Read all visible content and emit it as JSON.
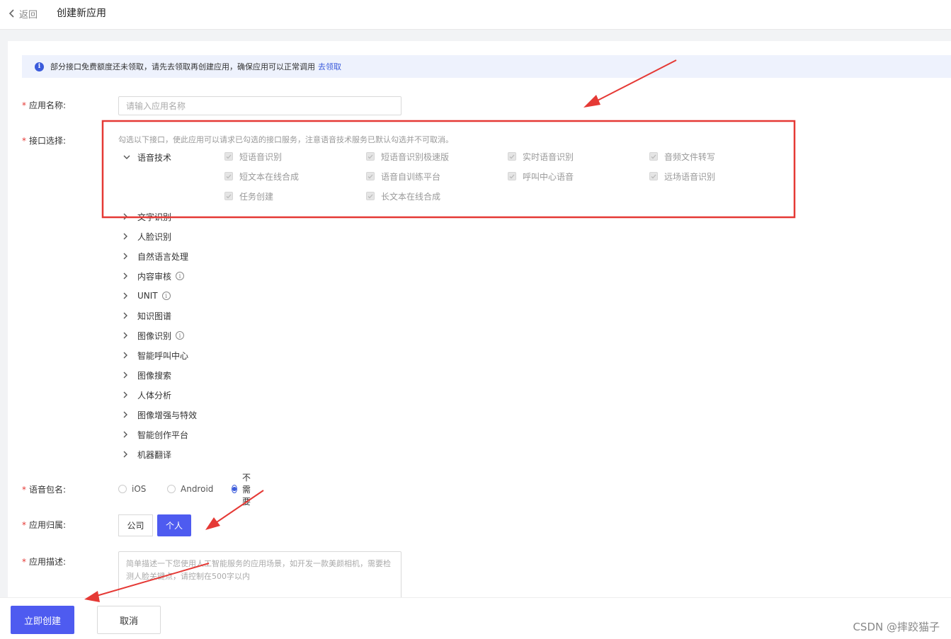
{
  "header": {
    "back_label": "返回",
    "title": "创建新应用"
  },
  "notice": {
    "text": "部分接口免费额度还未领取，请先去领取再创建应用，确保应用可以正常调用",
    "link": "去领取"
  },
  "form": {
    "app_name": {
      "label": "应用名称:",
      "placeholder": "请输入应用名称"
    },
    "api_select": {
      "label": "接口选择:",
      "hint": "勾选以下接口，使此应用可以请求已勾选的接口服务，注意语音技术服务已默认勾选并不可取消。",
      "expanded_group": "语音技术",
      "speech_apis": [
        "短语音识别",
        "短语音识别极速版",
        "实时语音识别",
        "音频文件转写",
        "短文本在线合成",
        "语音自训练平台",
        "呼叫中心语音",
        "远场语音识别",
        "任务创建",
        "长文本在线合成"
      ],
      "groups": [
        "文字识别",
        "人脸识别",
        "自然语言处理",
        "内容审核",
        "UNIT",
        "知识图谱",
        "图像识别",
        "智能呼叫中心",
        "图像搜索",
        "人体分析",
        "图像增强与特效",
        "智能创作平台",
        "机器翻译"
      ]
    },
    "package_name": {
      "label": "语音包名:",
      "options": [
        "iOS",
        "Android",
        "不需要"
      ],
      "selected": "不需要"
    },
    "ownership": {
      "label": "应用归属:",
      "options": [
        "公司",
        "个人"
      ],
      "selected": "个人"
    },
    "description": {
      "label": "应用描述:",
      "placeholder": "简单描述一下您使用人工智能服务的应用场景，如开发一款美颜相机，需要检测人脸关键点，请控制在500字以内"
    }
  },
  "footer": {
    "create_label": "立即创建",
    "cancel_label": "取消"
  },
  "watermark": "CSDN @摔跤猫子",
  "colors": {
    "primary": "#4e5bf0",
    "link": "#3b5bdb",
    "annotation": "#e53935"
  }
}
